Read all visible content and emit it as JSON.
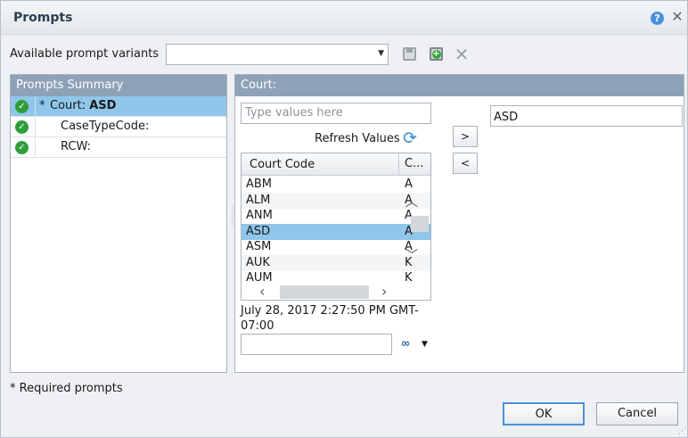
{
  "dialog": {
    "title": "Prompts",
    "help_icon": "help-icon",
    "close_icon": "close-icon"
  },
  "variants": {
    "label": "Available prompt variants",
    "value": "",
    "icons": [
      "save-icon",
      "save-as-icon",
      "delete-icon"
    ]
  },
  "summary": {
    "header": "Prompts Summary",
    "items": [
      {
        "required": "*",
        "label": "Court:",
        "value": "ASD",
        "status": "check-icon",
        "selected": true
      },
      {
        "required": "",
        "label": "CaseTypeCode:",
        "value": "",
        "status": "check-icon",
        "selected": false
      },
      {
        "required": "",
        "label": "RCW:",
        "value": "",
        "status": "check-icon",
        "selected": false
      }
    ]
  },
  "court": {
    "header": "Court:",
    "search_placeholder": "Type values here",
    "refresh_label": "Refresh Values",
    "columns": [
      "Court Code",
      "C..."
    ],
    "rows": [
      {
        "code": "ABM",
        "desc": "A"
      },
      {
        "code": "ALM",
        "desc": "A"
      },
      {
        "code": "ANM",
        "desc": "A"
      },
      {
        "code": "ASD",
        "desc": "A"
      },
      {
        "code": "ASM",
        "desc": "A"
      },
      {
        "code": "AUK",
        "desc": "K"
      },
      {
        "code": "AUM",
        "desc": "K"
      }
    ],
    "selected_row": "ASD",
    "timestamp": "July 28, 2017 2:27:50 PM GMT-07:00",
    "add_label": ">",
    "remove_label": "<",
    "selected_values": [
      "ASD"
    ]
  },
  "footer": {
    "required_note": "* Required prompts",
    "ok_label": "OK",
    "cancel_label": "Cancel"
  },
  "colors": {
    "header_bg": "#8ea2b7",
    "selection": "#8fc6ea",
    "check": "#2f9e3a",
    "focus": "#4a90d9"
  }
}
